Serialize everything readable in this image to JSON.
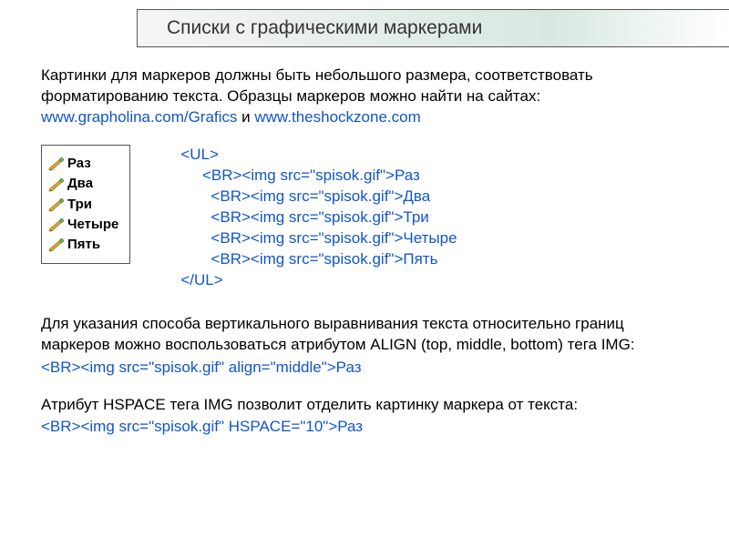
{
  "title": "Списки с графическими маркерами",
  "intro": {
    "text1": "Картинки для маркеров должны быть небольшого размера, соответствовать форматированию текста. Образцы маркеров можно найти на сайтах:",
    "link1": "www.grapholina.com/Grafics",
    "sep": " и ",
    "link2": "www.theshockzone.com"
  },
  "example_items": [
    "Раз",
    "Два",
    "Три",
    "Четыре",
    "Пять"
  ],
  "code_block": "<UL>\n     <BR><img src=\"spisok.gif\">Раз\n       <BR><img src=\"spisok.gif\">Два\n       <BR><img src=\"spisok.gif\">Три\n       <BR><img src=\"spisok.gif\">Четыре\n       <BR><img src=\"spisok.gif\">Пять\n</UL>",
  "para2": "Для указания способа вертикального выравнивания текста относительно границ маркеров можно воспользоваться атрибутом ALIGN (top, middle, bottom) тега IMG:",
  "code2": "<BR><img src=\"spisok.gif\" align=\"middle\">Раз",
  "para3": "Атрибут HSPACE тега IMG позволит отделить картинку маркера от текста:",
  "code3": "<BR><img src=\"spisok.gif\" HSPACE=\"10\">Раз"
}
